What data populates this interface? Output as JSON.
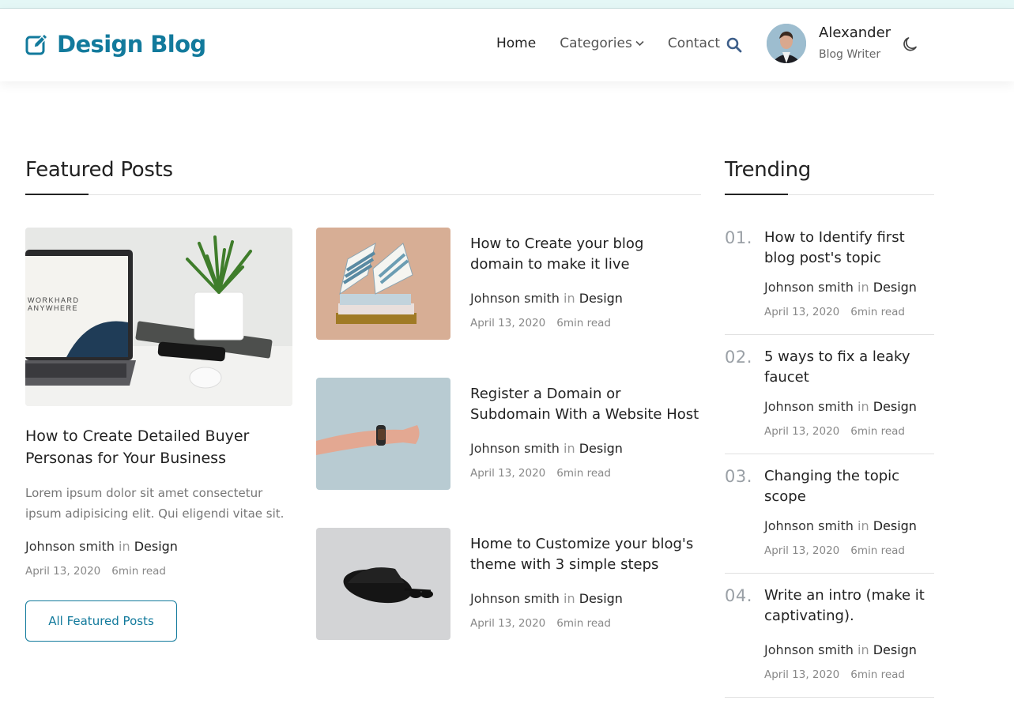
{
  "header": {
    "logo_text": "Design Blog",
    "nav": [
      {
        "label": "Home"
      },
      {
        "label": "Categories"
      },
      {
        "label": "Contact"
      }
    ],
    "user": {
      "name": "Alexander",
      "role": "Blog Writer"
    }
  },
  "featured": {
    "title": "Featured Posts",
    "main": {
      "title": "How to Create Detailed Buyer Personas for Your Business",
      "excerpt": "Lorem ipsum dolor sit amet consectetur ipsum adipisicing elit. Qui eligendi vitae sit.",
      "author": "Johnson smith",
      "in": "in",
      "category": "Design",
      "date": "April 13, 2020",
      "read": "6min read"
    },
    "button_label": "All Featured Posts",
    "posts": [
      {
        "title": "How to Create your blog domain to make it live",
        "author": "Johnson smith",
        "in": "in",
        "category": "Design",
        "date": "April 13, 2020",
        "read": "6min read"
      },
      {
        "title": "Register a Domain or Subdomain With a Website Host",
        "author": "Johnson smith",
        "in": "in",
        "category": "Design",
        "date": "April 13, 2020",
        "read": "6min read"
      },
      {
        "title": "Home to Customize your blog's theme with 3 simple steps",
        "author": "Johnson smith",
        "in": "in",
        "category": "Design",
        "date": "April 13, 2020",
        "read": "6min read"
      }
    ]
  },
  "trending": {
    "title": "Trending",
    "items": [
      {
        "num": "01.",
        "title": "How to Identify first blog post's topic",
        "author": "Johnson smith",
        "in": "in",
        "category": "Design",
        "date": "April 13, 2020",
        "read": "6min read"
      },
      {
        "num": "02.",
        "title": "5 ways to fix a leaky faucet",
        "author": "Johnson smith",
        "in": "in",
        "category": "Design",
        "date": "April 13, 2020",
        "read": "6min read"
      },
      {
        "num": "03.",
        "title": "Changing the topic scope",
        "author": "Johnson smith",
        "in": "in",
        "category": "Design",
        "date": "April 13, 2020",
        "read": "6min read"
      },
      {
        "num": "04.",
        "title": "Write an intro (make it captivating).",
        "author": "Johnson smith",
        "in": "in",
        "category": "Design",
        "date": "April 13, 2020",
        "read": "6min read"
      }
    ]
  },
  "colors": {
    "brand": "#127a9c",
    "text": "#222222",
    "muted": "#888888"
  }
}
